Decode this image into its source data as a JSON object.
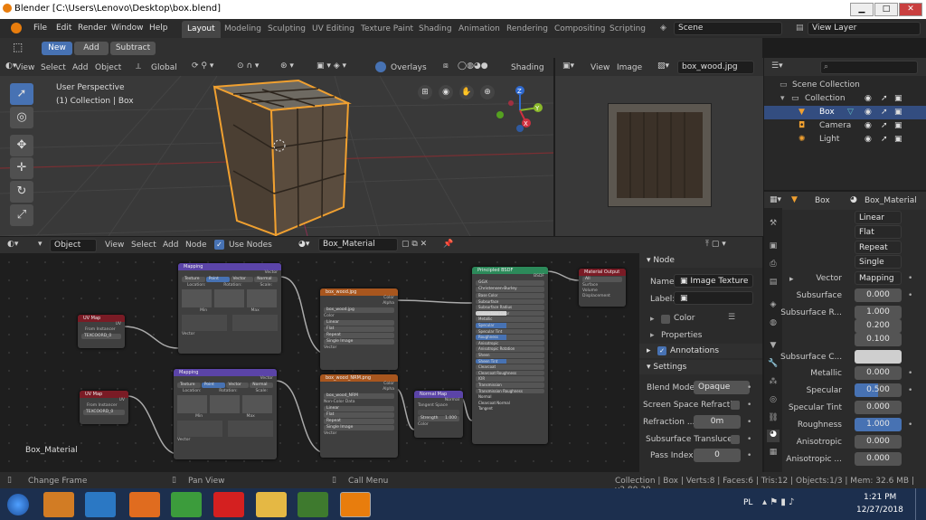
{
  "window": {
    "title": "Blender [C:\\Users\\Lenovo\\Desktop\\box.blend]",
    "min": "▁",
    "max": "□",
    "close": "✕"
  },
  "menu": [
    "File",
    "Edit",
    "Render",
    "Window",
    "Help"
  ],
  "workspaces": [
    "Layout",
    "Modeling",
    "Sculpting",
    "UV Editing",
    "Texture Paint",
    "Shading",
    "Animation",
    "Rendering",
    "Compositing",
    "Scripting"
  ],
  "scene": "Scene",
  "view_layer": "View Layer",
  "toolhdr": {
    "new": "New",
    "add": "Add",
    "subtract": "Subtract"
  },
  "viewport": {
    "menus": [
      "View",
      "Select",
      "Add",
      "Object"
    ],
    "transform": "Global",
    "overlays": "Overlays",
    "shading": "Shading",
    "info1": "User Perspective",
    "info2": "(1) Collection | Box",
    "axis": {
      "x": "X",
      "y": "Y",
      "z": "Z"
    }
  },
  "image_editor": {
    "menus": [
      "View",
      "Image"
    ],
    "image": "box_wood.jpg"
  },
  "outliner": {
    "items": [
      {
        "label": "Scene Collection"
      },
      {
        "label": "Collection"
      },
      {
        "label": "Box"
      },
      {
        "label": "Camera"
      },
      {
        "label": "Light"
      }
    ]
  },
  "properties": {
    "object": "Box",
    "material": "Box_Material",
    "dropdowns": [
      "Linear",
      "Flat",
      "Repeat",
      "Single Image"
    ],
    "rows": [
      {
        "label": "Vector",
        "value": "Mapping"
      },
      {
        "label": "Subsurface",
        "value": "0.000"
      },
      {
        "label": "Subsurface R...",
        "value": "1.000"
      },
      {
        "label": "",
        "value": "0.200"
      },
      {
        "label": "",
        "value": "0.100"
      },
      {
        "label": "Subsurface C...",
        "value": ""
      },
      {
        "label": "Metallic",
        "value": "0.000"
      },
      {
        "label": "Specular",
        "value": "0.500"
      },
      {
        "label": "Specular Tint",
        "value": "0.000"
      },
      {
        "label": "Roughness",
        "value": "1.000"
      },
      {
        "label": "Anisotropic",
        "value": "0.000"
      },
      {
        "label": "Anisotropic ...",
        "value": "0.000"
      }
    ]
  },
  "node_editor": {
    "object": "Object",
    "menus": [
      "View",
      "Select",
      "Add",
      "Node"
    ],
    "use_nodes": "Use Nodes",
    "material": "Box_Material",
    "frame_label": "Box_Material",
    "nodes": {
      "uvmap1": {
        "title": "UV Map",
        "out": "UV",
        "f1": "From Instancer",
        "f2": "TEXCOORD_0"
      },
      "uvmap2": {
        "title": "UV Map",
        "out": "UV",
        "f1": "From Instancer",
        "f2": "TEXCOORD_0"
      },
      "mapping1": {
        "title": "Mapping",
        "out": "Vector",
        "tabs": [
          "Texture",
          "Point",
          "Vector",
          "Normal"
        ],
        "cols": [
          "Location:",
          "Rotation:",
          "Scale:"
        ],
        "min": "Min",
        "max": "Max",
        "in": "Vector"
      },
      "mapping2": {
        "title": "Mapping",
        "out": "Vector",
        "tabs": [
          "Texture",
          "Point",
          "Vector",
          "Normal"
        ],
        "cols": [
          "Location:",
          "Rotation:",
          "Scale:"
        ],
        "min": "Min",
        "max": "Max",
        "in": "Vector"
      },
      "tex1": {
        "title": "box_wood.jpg",
        "o1": "Color",
        "o2": "Alpha",
        "file": "box_wood.jpg",
        "f1": "Color",
        "f2": "Linear",
        "f3": "Flat",
        "f4": "Repeat",
        "f5": "Single Image",
        "in": "Vector"
      },
      "tex2": {
        "title": "box_wood_NRM.png",
        "o1": "Color",
        "o2": "Alpha",
        "file": "box_wood_NRM",
        "f1": "Non-Color Data",
        "f2": "Linear",
        "f3": "Flat",
        "f4": "Repeat",
        "f5": "Single Image",
        "in": "Vector"
      },
      "normalmap": {
        "title": "Normal Map",
        "out": "Normal",
        "f1": "Tangent Space",
        "f2": "Strength",
        "f2v": "1.000",
        "in": "Color"
      },
      "bsdf": {
        "title": "Principled BSDF",
        "out": "BSDF",
        "f1": "GGX",
        "f2": "Christensen-Burley",
        "rows": [
          "Base Color",
          "Subsurface",
          "Subsurface Radius",
          "Subsurface Color",
          "Metallic",
          "Specular",
          "Specular Tint",
          "Roughness",
          "Anisotropic",
          "Anisotropic Rotation",
          "Sheen",
          "Sheen Tint",
          "Clearcoat",
          "Clearcoat Roughness",
          "IOR",
          "Transmission",
          "Transmission Roughness",
          "Normal",
          "Clearcoat Normal",
          "Tangent"
        ]
      },
      "output": {
        "title": "Material Output",
        "f1": "All",
        "r1": "Surface",
        "r2": "Volume",
        "r3": "Displacement"
      }
    }
  },
  "npanel": {
    "node_section": "Node",
    "name_label": "Name:",
    "name_value": "Image Texture",
    "label_label": "Label:",
    "color": "Color",
    "properties": "Properties",
    "annotations": "Annotations",
    "settings": "Settings",
    "settings_rows": [
      {
        "label": "Blend Mode",
        "value": "Opaque"
      },
      {
        "label": "Screen Space Refracti...",
        "value": ""
      },
      {
        "label": "Refraction ...",
        "value": "0m"
      },
      {
        "label": "Subsurface Transluce...",
        "value": ""
      },
      {
        "label": "Pass Index",
        "value": "0"
      }
    ]
  },
  "status": {
    "left": "Change Frame",
    "mid": "Pan View",
    "call": "Call Menu",
    "right": "Collection | Box | Verts:8 | Faces:6 | Tris:12 | Objects:1/3 | Mem: 32.6 MB | v2.80.39"
  },
  "taskbar": {
    "lang": "PL",
    "time": "1:21 PM",
    "date": "12/27/2018"
  }
}
